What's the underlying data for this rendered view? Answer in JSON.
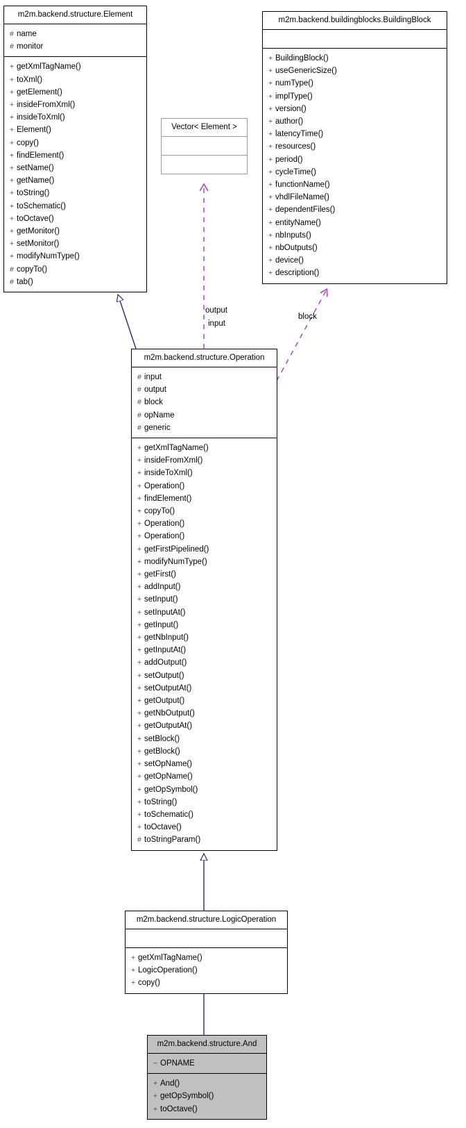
{
  "diagram": {
    "title": "UML class inheritance and collaboration diagram",
    "colors": {
      "inheritance_edge": "#2a2a7a",
      "usage_edge": "#b040c8",
      "box_border": "#000000",
      "light_border": "#9a9a9a",
      "highlight_fill": "#c0c0c0",
      "background": "#ffffff"
    }
  },
  "classes": {
    "element": {
      "title": "m2m.backend.structure.Element",
      "attributes": [
        {
          "vis": "#",
          "name": "name"
        },
        {
          "vis": "#",
          "name": "monitor"
        }
      ],
      "methods": [
        {
          "vis": "+",
          "name": "getXmlTagName()"
        },
        {
          "vis": "+",
          "name": "toXml()"
        },
        {
          "vis": "+",
          "name": "getElement()"
        },
        {
          "vis": "+",
          "name": "insideFromXml()"
        },
        {
          "vis": "+",
          "name": "insideToXml()"
        },
        {
          "vis": "+",
          "name": "Element()"
        },
        {
          "vis": "+",
          "name": "copy()"
        },
        {
          "vis": "+",
          "name": "findElement()"
        },
        {
          "vis": "+",
          "name": "setName()"
        },
        {
          "vis": "+",
          "name": "getName()"
        },
        {
          "vis": "+",
          "name": "toString()"
        },
        {
          "vis": "+",
          "name": "toSchematic()"
        },
        {
          "vis": "+",
          "name": "toOctave()"
        },
        {
          "vis": "+",
          "name": "getMonitor()"
        },
        {
          "vis": "+",
          "name": "setMonitor()"
        },
        {
          "vis": "+",
          "name": "modifyNumType()"
        },
        {
          "vis": "#",
          "name": "copyTo()"
        },
        {
          "vis": "#",
          "name": "tab()"
        }
      ]
    },
    "buildingblock": {
      "title": "m2m.backend.buildingblocks.BuildingBlock",
      "attributes": [],
      "methods": [
        {
          "vis": "+",
          "name": "BuildingBlock()"
        },
        {
          "vis": "+",
          "name": "useGenericSize()"
        },
        {
          "vis": "+",
          "name": "numType()"
        },
        {
          "vis": "+",
          "name": "implType()"
        },
        {
          "vis": "+",
          "name": "version()"
        },
        {
          "vis": "+",
          "name": "author()"
        },
        {
          "vis": "+",
          "name": "latencyTime()"
        },
        {
          "vis": "+",
          "name": "resources()"
        },
        {
          "vis": "+",
          "name": "period()"
        },
        {
          "vis": "+",
          "name": "cycleTime()"
        },
        {
          "vis": "+",
          "name": "functionName()"
        },
        {
          "vis": "+",
          "name": "vhdlFileName()"
        },
        {
          "vis": "+",
          "name": "dependentFiles()"
        },
        {
          "vis": "+",
          "name": "entityName()"
        },
        {
          "vis": "+",
          "name": "nbInputs()"
        },
        {
          "vis": "+",
          "name": "nbOutputs()"
        },
        {
          "vis": "+",
          "name": "device()"
        },
        {
          "vis": "+",
          "name": "description()"
        }
      ]
    },
    "vector": {
      "title": "Vector< Element >",
      "attributes": [],
      "methods": []
    },
    "operation": {
      "title": "m2m.backend.structure.Operation",
      "attributes": [
        {
          "vis": "#",
          "name": "input"
        },
        {
          "vis": "#",
          "name": "output"
        },
        {
          "vis": "#",
          "name": "block"
        },
        {
          "vis": "#",
          "name": "opName"
        },
        {
          "vis": "#",
          "name": "generic"
        }
      ],
      "methods": [
        {
          "vis": "+",
          "name": "getXmlTagName()"
        },
        {
          "vis": "+",
          "name": "insideFromXml()"
        },
        {
          "vis": "+",
          "name": "insideToXml()"
        },
        {
          "vis": "+",
          "name": "Operation()"
        },
        {
          "vis": "+",
          "name": "findElement()"
        },
        {
          "vis": "+",
          "name": "copyTo()"
        },
        {
          "vis": "+",
          "name": "Operation()"
        },
        {
          "vis": "+",
          "name": "Operation()"
        },
        {
          "vis": "+",
          "name": "getFirstPipelined()"
        },
        {
          "vis": "+",
          "name": "modifyNumType()"
        },
        {
          "vis": "+",
          "name": "getFirst()"
        },
        {
          "vis": "+",
          "name": "addInput()"
        },
        {
          "vis": "+",
          "name": "setInput()"
        },
        {
          "vis": "+",
          "name": "setInputAt()"
        },
        {
          "vis": "+",
          "name": "getInput()"
        },
        {
          "vis": "+",
          "name": "getNbInput()"
        },
        {
          "vis": "+",
          "name": "getInputAt()"
        },
        {
          "vis": "+",
          "name": "addOutput()"
        },
        {
          "vis": "+",
          "name": "setOutput()"
        },
        {
          "vis": "+",
          "name": "setOutputAt()"
        },
        {
          "vis": "+",
          "name": "getOutput()"
        },
        {
          "vis": "+",
          "name": "getNbOutput()"
        },
        {
          "vis": "+",
          "name": "getOutputAt()"
        },
        {
          "vis": "+",
          "name": "setBlock()"
        },
        {
          "vis": "+",
          "name": "getBlock()"
        },
        {
          "vis": "+",
          "name": "setOpName()"
        },
        {
          "vis": "+",
          "name": "getOpName()"
        },
        {
          "vis": "+",
          "name": "getOpSymbol()"
        },
        {
          "vis": "+",
          "name": "toString()"
        },
        {
          "vis": "+",
          "name": "toSchematic()"
        },
        {
          "vis": "+",
          "name": "toOctave()"
        },
        {
          "vis": "#",
          "name": "toStringParam()"
        }
      ]
    },
    "logicoperation": {
      "title": "m2m.backend.structure.LogicOperation",
      "attributes": [],
      "methods": [
        {
          "vis": "+",
          "name": "getXmlTagName()"
        },
        {
          "vis": "+",
          "name": "LogicOperation()"
        },
        {
          "vis": "+",
          "name": "copy()"
        }
      ]
    },
    "and": {
      "title": "m2m.backend.structure.And",
      "attributes": [
        {
          "vis": "~",
          "name": "OPNAME"
        }
      ],
      "methods": [
        {
          "vis": "+",
          "name": "And()"
        },
        {
          "vis": "+",
          "name": "getOpSymbol()"
        },
        {
          "vis": "+",
          "name": "toOctave()"
        }
      ]
    }
  },
  "edge_labels": {
    "output": "output",
    "input": "input",
    "block": "block"
  }
}
